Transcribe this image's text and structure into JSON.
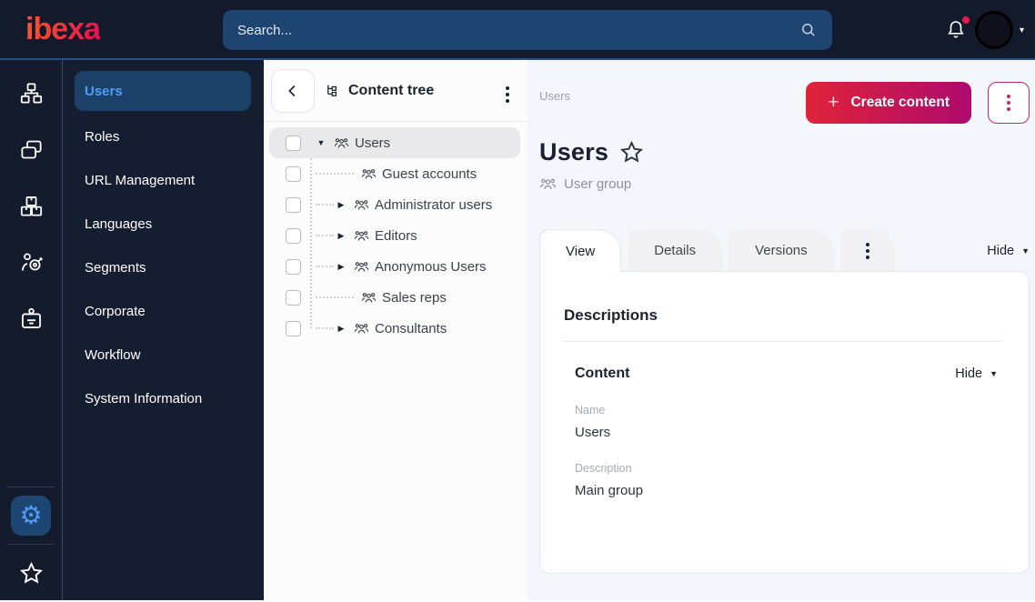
{
  "topbar": {
    "logo_text": "ibexa",
    "search_placeholder": "Search...",
    "icons": [
      "search-icon",
      "bell-icon",
      "chevron-down-icon"
    ]
  },
  "rail": {
    "items": [
      {
        "name": "sitemap-icon"
      },
      {
        "name": "pages-icon"
      },
      {
        "name": "boxes-icon"
      },
      {
        "name": "personalization-icon"
      },
      {
        "name": "badge-icon"
      }
    ],
    "bottom": [
      {
        "name": "gear-icon",
        "active": true
      },
      {
        "name": "star-icon"
      }
    ]
  },
  "sidebar": {
    "items": [
      {
        "label": "Users",
        "active": true
      },
      {
        "label": "Roles"
      },
      {
        "label": "URL Management"
      },
      {
        "label": "Languages"
      },
      {
        "label": "Segments"
      },
      {
        "label": "Corporate"
      },
      {
        "label": "Workflow"
      },
      {
        "label": "System Information"
      }
    ]
  },
  "content_tree": {
    "title": "Content tree",
    "items": [
      {
        "label": "Users",
        "level": 0,
        "state": "expanded",
        "selected": true
      },
      {
        "label": "Guest accounts",
        "level": 1,
        "state": "leaf"
      },
      {
        "label": "Administrator users",
        "level": 1,
        "state": "collapsed"
      },
      {
        "label": "Editors",
        "level": 1,
        "state": "collapsed"
      },
      {
        "label": "Anonymous Users",
        "level": 1,
        "state": "collapsed"
      },
      {
        "label": "Sales reps",
        "level": 1,
        "state": "leaf"
      },
      {
        "label": "Consultants",
        "level": 1,
        "state": "collapsed"
      }
    ]
  },
  "main": {
    "breadcrumb": "Users",
    "create_button": "Create content",
    "title": "Users",
    "content_type": "User group",
    "tabs": [
      {
        "label": "View",
        "active": true
      },
      {
        "label": "Details"
      },
      {
        "label": "Versions"
      },
      {
        "icon": "kebab-icon"
      }
    ],
    "hide_toggle": "Hide",
    "card": {
      "heading": "Descriptions",
      "section": {
        "title": "Content",
        "hide_toggle": "Hide",
        "fields": [
          {
            "label": "Name",
            "value": "Users"
          },
          {
            "label": "Description",
            "value": "Main group"
          }
        ]
      }
    }
  },
  "colors": {
    "accent_gradient_start": "#e02339",
    "accent_gradient_end": "#ae0a6e",
    "active_blue": "#4f9cf8",
    "notification_red": "#e8174a",
    "topbar_bg": "#121a2c",
    "sidebar_bg": "#151e30"
  }
}
